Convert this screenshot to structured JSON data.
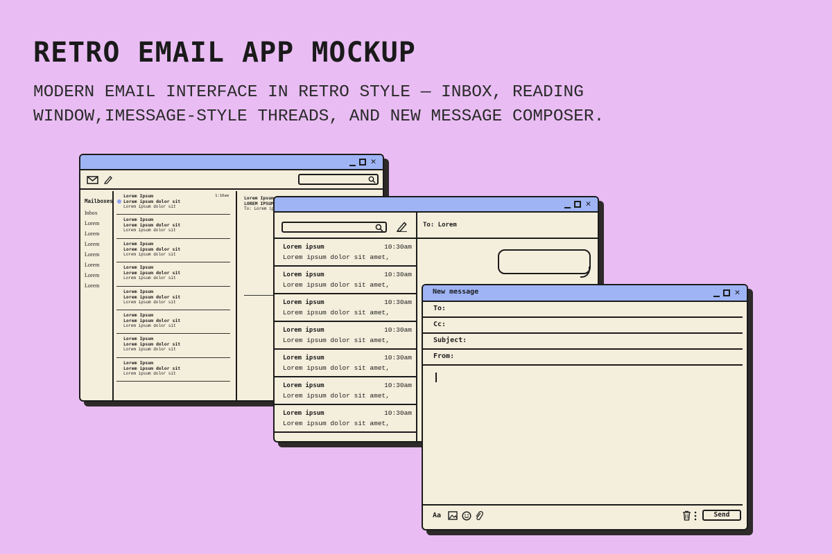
{
  "headline": "RETRO EMAIL APP MOCKUP",
  "subtitle_line1": "MODERN EMAIL INTERFACE IN RETRO STYLE — INBOX, READING",
  "subtitle_line2": "WINDOW,IMESSAGE-STYLE THREADS, AND NEW MESSAGE COMPOSER.",
  "window_controls": {
    "close": "✕"
  },
  "inbox_window": {
    "mailboxes_title": "Mailboxes",
    "mailboxes": [
      "Inbox",
      "Lorem",
      "Lorem",
      "Lorem",
      "Lorem",
      "Lorem",
      "Lorem",
      "Lorem"
    ],
    "messages": [
      {
        "sender": "Lorem Ipsum",
        "subject": "Lorem ipsum dolor sit",
        "preview": "Lorem ipsum dolor sit",
        "time": "1:10am"
      },
      {
        "sender": "Lorem Ipsum",
        "subject": "Lorem ipsum dolor sit",
        "preview": "Lorem ipsum dolor sit"
      },
      {
        "sender": "Lorem Ipsum",
        "subject": "Lorem ipsum dolor sit",
        "preview": "Lorem ipsum dolor sit"
      },
      {
        "sender": "Lorem Ipsum",
        "subject": "Lorem ipsum dolor sit",
        "preview": "Lorem ipsum dolor sit"
      },
      {
        "sender": "Lorem Ipsum",
        "subject": "Lorem ipsum dolor sit",
        "preview": "Lorem ipsum dolor sit"
      },
      {
        "sender": "Lorem Ipsum",
        "subject": "Lorem ipsum dolor sit",
        "preview": "Lorem ipsum dolor sit"
      },
      {
        "sender": "Lorem Ipsum",
        "subject": "Lorem ipsum dolor sit",
        "preview": "Lorem ipsum dolor sit"
      },
      {
        "sender": "Lorem Ipsum",
        "subject": "Lorem ipsum dolor sit",
        "preview": "Lorem ipsum dolor sit"
      }
    ],
    "reader": {
      "from": "Lorem Ipsum",
      "subject": "LOREM IPSUM",
      "to": "To: Lorem ipsum"
    }
  },
  "threads_window": {
    "to_label": "To: Lorem",
    "threads": [
      {
        "sender": "Lorem ipsum",
        "time": "10:30am",
        "preview": "Lorem ipsum dolor sit amet,"
      },
      {
        "sender": "Lorem ipsum",
        "time": "10:30am",
        "preview": "Lorem ipsum dolor sit amet,"
      },
      {
        "sender": "Lorem ipsum",
        "time": "10:30am",
        "preview": "Lorem ipsum dolor sit amet,"
      },
      {
        "sender": "Lorem ipsum",
        "time": "10:30am",
        "preview": "Lorem ipsum dolor sit amet,"
      },
      {
        "sender": "Lorem ipsum",
        "time": "10:30am",
        "preview": "Lorem ipsum dolor sit amet,"
      },
      {
        "sender": "Lorem ipsum",
        "time": "10:30am",
        "preview": "Lorem ipsum dolor sit amet,"
      },
      {
        "sender": "Lorem ipsum",
        "time": "10:30am",
        "preview": "Lorem ipsum dolor sit amet,"
      }
    ]
  },
  "composer_window": {
    "title": "New message",
    "to_label": "To:",
    "cc_label": "Cc:",
    "subject_label": "Subject:",
    "from_label": "From:",
    "format_label": "Aa",
    "send_label": "Send"
  },
  "icons": [
    "envelope-icon",
    "pencil-icon",
    "search-icon",
    "image-icon",
    "emoji-icon",
    "paperclip-icon",
    "trash-icon",
    "more-icon"
  ],
  "colors": {
    "background": "#e9bdf3",
    "titlebar": "#9eb4f5",
    "window": "#f4eedc",
    "unread_dot": "#8ca3f0"
  }
}
